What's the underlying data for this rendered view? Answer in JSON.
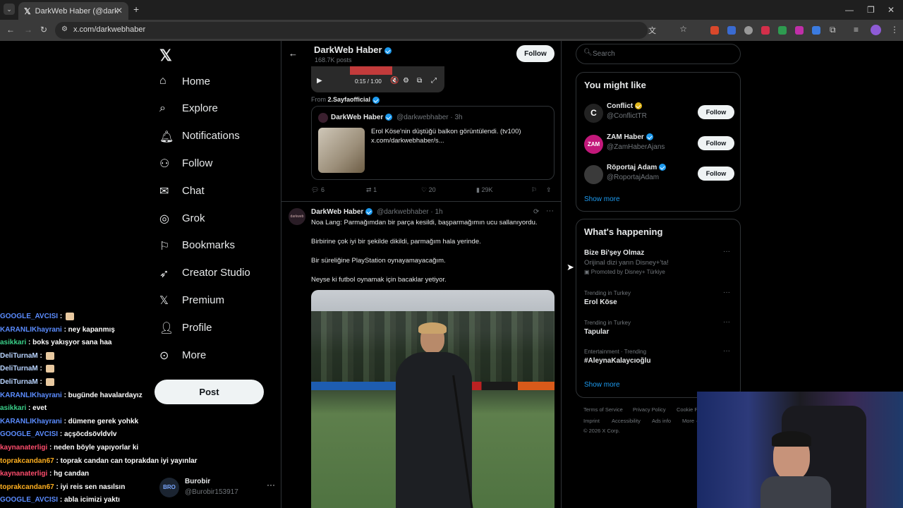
{
  "browser": {
    "tab_title": "DarkWeb Haber (@darkwebhab",
    "url": "x.com/darkwebhaber"
  },
  "nav": {
    "items": [
      {
        "label": "Home",
        "icon": "home-icon"
      },
      {
        "label": "Explore",
        "icon": "search-icon"
      },
      {
        "label": "Notifications",
        "icon": "bell-icon"
      },
      {
        "label": "Follow",
        "icon": "add-person-icon"
      },
      {
        "label": "Chat",
        "icon": "mail-icon"
      },
      {
        "label": "Grok",
        "icon": "grok-icon"
      },
      {
        "label": "Bookmarks",
        "icon": "bookmark-icon"
      },
      {
        "label": "Creator Studio",
        "icon": "rocket-icon"
      },
      {
        "label": "Premium",
        "icon": "x-logo-icon"
      },
      {
        "label": "Profile",
        "icon": "person-icon"
      },
      {
        "label": "More",
        "icon": "more-circle-icon"
      }
    ],
    "post_label": "Post",
    "account": {
      "name": "Burobir",
      "handle": "@Burobir153917"
    }
  },
  "chat": [
    {
      "user": "GOOGLE_AVCISI",
      "msg": " : ",
      "color": "#5b8cff"
    },
    {
      "user": "KARANLIKhayrani",
      "msg": " : ney kapanmış",
      "color": "#5b8cff"
    },
    {
      "user": "asikkari",
      "msg": " : boks yakışyor sana haa",
      "color": "#3ad18a"
    },
    {
      "user": "DeliTurnaM",
      "msg": " : ",
      "color": "#b9d4ff"
    },
    {
      "user": "DeliTurnaM",
      "msg": " : ",
      "color": "#b9d4ff"
    },
    {
      "user": "DeliTurnaM",
      "msg": " : ",
      "color": "#b9d4ff"
    },
    {
      "user": "KARANLIKhayrani",
      "msg": " : bugünde havalardayız",
      "color": "#5b8cff"
    },
    {
      "user": "asikkari",
      "msg": " : evet",
      "color": "#3ad18a"
    },
    {
      "user": "KARANLIKhayrani",
      "msg": " : dümene gerek yohkk",
      "color": "#5b8cff"
    },
    {
      "user": "GOOGLE_AVCISI",
      "msg": " : açşöcdsövldvlv",
      "color": "#5b8cff"
    },
    {
      "user": "kaynanaterligi",
      "msg": " : neden böyle yapıyorlar ki",
      "color": "#ff4d6d"
    },
    {
      "user": "toprakcandan67",
      "msg": " : toprak candan can toprakdan iyi yayınlar",
      "color": "#ffb020"
    },
    {
      "user": "kaynanaterligi",
      "msg": " : hg candan",
      "color": "#ff4d6d"
    },
    {
      "user": "toprakcandan67",
      "msg": " : iyi reis sen nasılsın",
      "color": "#ffb020"
    },
    {
      "user": "GOOGLE_AVCISI",
      "msg": " : abla icimizi yaktı",
      "color": "#5b8cff"
    }
  ],
  "profile_header": {
    "name": "DarkWeb Haber",
    "posts": "168.7K posts",
    "follow_label": "Follow"
  },
  "video": {
    "time": "0:15 / 1:00"
  },
  "from": {
    "prefix": "From",
    "account": "2.Sayfaofficial"
  },
  "quote": {
    "name": "DarkWeb Haber",
    "handle": "@darkwebhaber",
    "time": "· 3h",
    "text1": "Erol Köse'nin düştüğü balkon görüntülendi. (tv100)",
    "text2": "x.com/darkwebhaber/s..."
  },
  "actions1": {
    "replies": "6",
    "reposts": "1",
    "likes": "20",
    "views": "29K"
  },
  "tweet2": {
    "name": "DarkWeb Haber",
    "handle": "@darkwebhaber",
    "time": "· 1h",
    "p1": "Noa Lang: Parmağımdan bir parça kesildi, başparmağımın ucu sallanıyordu.",
    "p2": "Birbirine çok iyi bir şekilde dikildi, parmağım hala yerinde.",
    "p3": "Bir süreliğine PlayStation oynayamayacağım.",
    "p4": "Neyse ki futbol oynamak için bacaklar yetiyor."
  },
  "search": {
    "placeholder": "Search"
  },
  "might_like": {
    "title": "You might like",
    "follow_label": "Follow",
    "users": [
      {
        "name": "Conflict",
        "handle": "@ConflictTR",
        "avatar": "C",
        "avbg": "#222",
        "gold": true
      },
      {
        "name": "ZAM Haber",
        "handle": "@ZamHaberAjans",
        "avatar": "ZAM",
        "avbg": "#c2187a",
        "gold": false
      },
      {
        "name": "Röportaj Adam",
        "handle": "@RoportajAdam",
        "avatar": "",
        "avbg": "#3a3a3a",
        "gold": false
      }
    ],
    "show_more": "Show more"
  },
  "happening": {
    "title": "What's happening",
    "promo": {
      "title": "Bize Bi'şey Olmaz",
      "sub": "Orijinal dizi yarın Disney+'ta!",
      "promoted": "Promoted by Disney+ Türkiye"
    },
    "trends": [
      {
        "context": "Trending in Turkey",
        "title": "Erol Köse"
      },
      {
        "context": "Trending in Turkey",
        "title": "Tapular"
      },
      {
        "context": "Entertainment · Trending",
        "title": "#AleynaKalaycıoğlu"
      }
    ],
    "show_more": "Show more"
  },
  "footer": {
    "links": [
      "Terms of Service",
      "Privacy Policy",
      "Cookie P",
      "Imprint",
      "Accessibility",
      "Ads info",
      "More ·"
    ],
    "copyright": "© 2026 X Corp."
  }
}
